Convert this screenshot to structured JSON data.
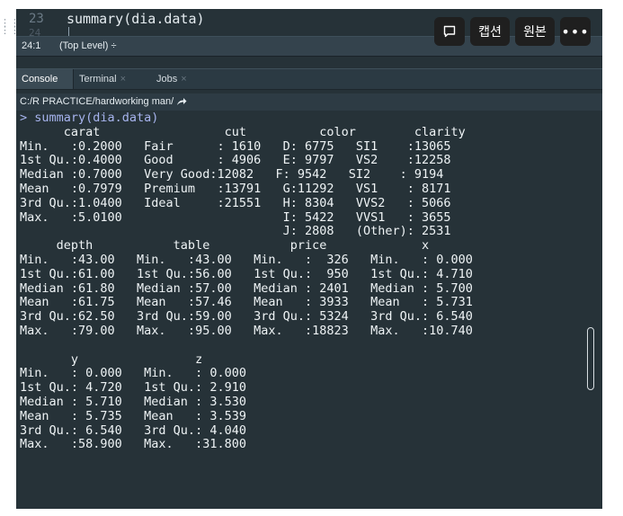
{
  "editor": {
    "line_number": "23",
    "next_line_number": "24",
    "code_line": "summary(dia.data)"
  },
  "statusbar": {
    "position": "24:1",
    "scope": "(Top Level) ÷"
  },
  "overlay_toolbar": {
    "comment_icon": "speech-bubble-icon",
    "caption_label": "캡션",
    "original_label": "원본",
    "more_label": "•••"
  },
  "tabs": [
    {
      "label": "Console",
      "closable": false
    },
    {
      "label": "Terminal",
      "closable": true
    },
    {
      "label": "Jobs",
      "closable": true
    }
  ],
  "path": {
    "text": "C:/R PRACTICE/hardworking man/",
    "icon": "share-arrow-icon"
  },
  "console": {
    "command_line": "> summary(dia.data)",
    "output_lines": [
      "      carat                 cut          color        clarity    ",
      "Min.   :0.2000   Fair      : 1610   D: 6775   SI1    :13065  ",
      "1st Qu.:0.4000   Good      : 4906   E: 9797   VS2    :12258  ",
      "Median :0.7000   Very Good:12082   F: 9542   SI2    : 9194  ",
      "Mean   :0.7979   Premium   :13791   G:11292   VS1    : 8171  ",
      "3rd Qu.:1.0400   Ideal     :21551   H: 8304   VVS2   : 5066  ",
      "Max.   :5.0100                      I: 5422   VVS1   : 3655  ",
      "                                    J: 2808   (Other): 2531  ",
      "     depth           table           price             x         ",
      "Min.   :43.00   Min.   :43.00   Min.   :  326   Min.   : 0.000  ",
      "1st Qu.:61.00   1st Qu.:56.00   1st Qu.:  950   1st Qu.: 4.710  ",
      "Median :61.80   Median :57.00   Median : 2401   Median : 5.700  ",
      "Mean   :61.75   Mean   :57.46   Mean   : 3933   Mean   : 5.731  ",
      "3rd Qu.:62.50   3rd Qu.:59.00   3rd Qu.: 5324   3rd Qu.: 6.540  ",
      "Max.   :79.00   Max.   :95.00   Max.   :18823   Max.   :10.740  ",
      "",
      "       y                z         ",
      "Min.   : 0.000   Min.   : 0.000  ",
      "1st Qu.: 4.720   1st Qu.: 2.910  ",
      "Median : 5.710   Median : 3.530  ",
      "Mean   : 5.735   Mean   : 3.539  ",
      "3rd Qu.: 6.540   3rd Qu.: 4.040  ",
      "Max.   :58.900   Max.   :31.800  "
    ]
  },
  "colors": {
    "console_bg": "#263238",
    "console_text": "#eef3f5",
    "command_text": "#a7b4ee",
    "toolbar_bg": "#1f1f1f"
  }
}
